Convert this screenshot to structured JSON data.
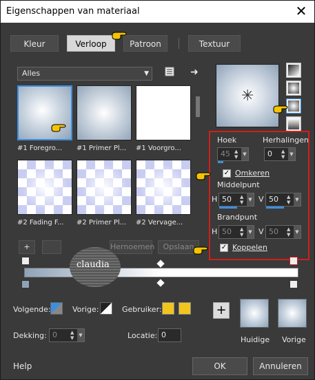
{
  "window": {
    "title": "Eigenschappen van materiaal",
    "close_glyph": "✕"
  },
  "tabs": [
    "Kleur",
    "Verloop",
    "Patroon",
    "Textuur"
  ],
  "active_tab": "Verloop",
  "library": {
    "dropdown_value": "Alles",
    "items": [
      {
        "caption": "#1 Foregro...",
        "selected": true
      },
      {
        "caption": "#1 Primer Pl..."
      },
      {
        "caption": "#1 Voorgro..."
      },
      {
        "caption": "#2 Fading F..."
      },
      {
        "caption": "#2 Primer Pl..."
      },
      {
        "caption": "#2 Vervage..."
      }
    ],
    "add_label": "+",
    "rename_label": "Hernoemen",
    "save_label": "Opslaan"
  },
  "settings": {
    "angle_label": "Hoek",
    "angle_value": "45",
    "repeats_label": "Herhalingen",
    "repeats_value": "0",
    "invert_label": "Omkeren",
    "invert_checked": true,
    "center_label": "Middelpunt",
    "center_h_label": "H",
    "center_h": "50",
    "center_v_label": "V",
    "center_v": "50",
    "focus_label": "Brandpunt",
    "focus_h_label": "H",
    "focus_h": "50",
    "focus_v_label": "V",
    "focus_v": "50",
    "link_label": "Koppelen",
    "link_checked": true
  },
  "watermark": {
    "text": "claudia"
  },
  "stops": {
    "next_label": "Volgende:",
    "prev_label": "Vorige:",
    "user_label": "Gebruiker:",
    "user_color": "#f2c41e",
    "opacity_label": "Dekking:",
    "opacity_value": "0",
    "location_label": "Locatie:",
    "location_value": "0"
  },
  "swatches": {
    "current_label": "Huidige",
    "previous_label": "Vorige",
    "add_label": "+"
  },
  "footer": {
    "help_label": "Help",
    "ok_label": "OK",
    "cancel_label": "Annuleren"
  },
  "colors": {
    "accent": "#3b8fe0",
    "highlight_border": "#d0201a",
    "gradient_start": "#8fa3b8",
    "gradient_end": "#ffffff"
  }
}
